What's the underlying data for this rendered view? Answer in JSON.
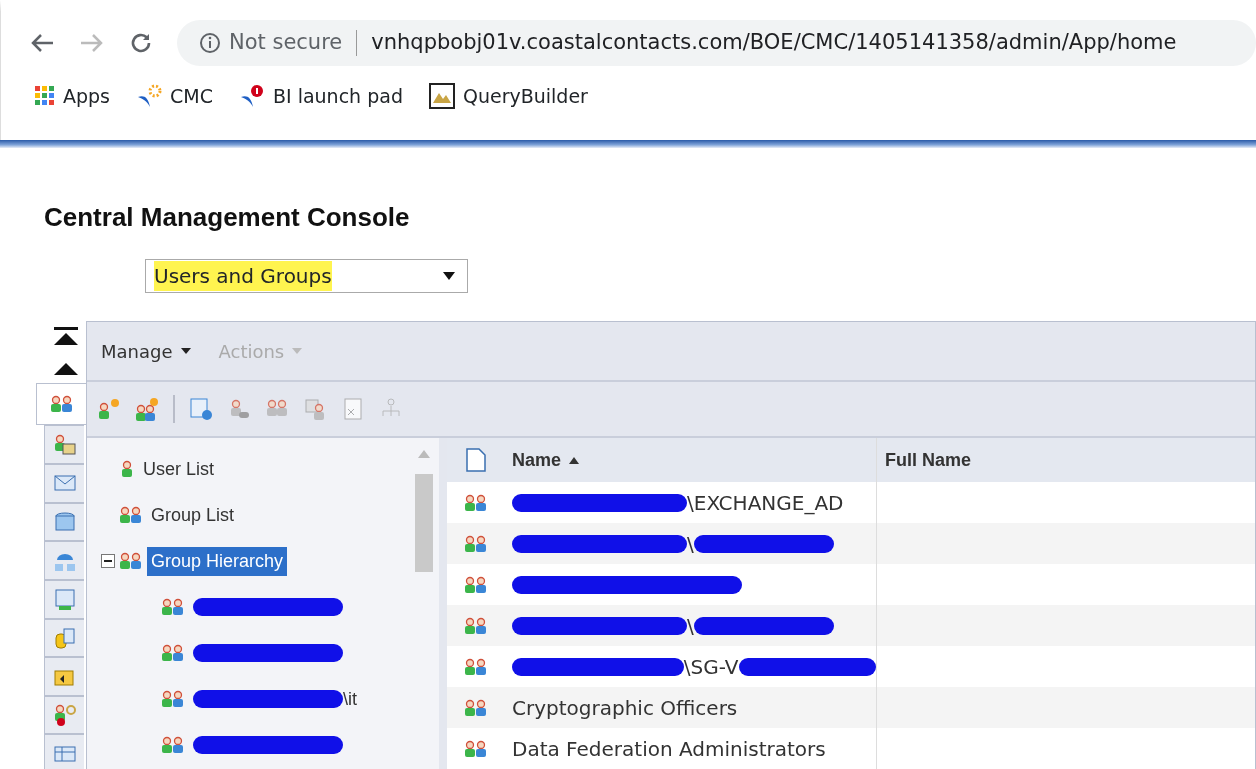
{
  "browser": {
    "security": "Not secure",
    "url": "vnhqpbobj01v.coastalcontacts.com/BOE/CMC/1405141358/admin/App/home",
    "bookmarks": [
      {
        "label": "Apps",
        "kind": "apps"
      },
      {
        "label": "CMC",
        "kind": "cmc"
      },
      {
        "label": "BI launch pad",
        "kind": "bi"
      },
      {
        "label": "QueryBuilder",
        "kind": "query"
      }
    ]
  },
  "page": {
    "title": "Central Management Console",
    "area_select": {
      "value": "Users and Groups",
      "highlighted": true
    }
  },
  "sidebar": {
    "tabs": [
      {
        "selected": true
      },
      {
        "selected": false
      },
      {
        "selected": false
      },
      {
        "selected": false
      },
      {
        "selected": false
      },
      {
        "selected": false
      },
      {
        "selected": false
      },
      {
        "selected": false
      },
      {
        "selected": false
      },
      {
        "selected": false
      }
    ]
  },
  "menu": [
    {
      "label": "Manage",
      "disabled": false
    },
    {
      "label": "Actions",
      "disabled": true
    }
  ],
  "toolbar": [
    {
      "kind": "button",
      "disabled": false
    },
    {
      "kind": "button",
      "disabled": false
    },
    {
      "kind": "separator"
    },
    {
      "kind": "button",
      "disabled": false
    },
    {
      "kind": "button",
      "disabled": true
    },
    {
      "kind": "button",
      "disabled": true
    },
    {
      "kind": "button",
      "disabled": true
    },
    {
      "kind": "button",
      "disabled": true
    },
    {
      "kind": "button",
      "disabled": true
    }
  ],
  "tree": [
    {
      "kind": "user",
      "parts": [
        {
          "kind": "text",
          "text": "User List"
        }
      ],
      "selected": false
    },
    {
      "kind": "group",
      "parts": [
        {
          "kind": "text",
          "text": "Group List"
        }
      ],
      "selected": false
    },
    {
      "kind": "group",
      "parts": [
        {
          "kind": "text",
          "text": "Group Hierarchy"
        }
      ],
      "selected": true,
      "expanded": true,
      "children": [
        {
          "kind": "group",
          "parts": [
            {
              "kind": "redacted"
            }
          ],
          "selected": false
        },
        {
          "kind": "group",
          "parts": [
            {
              "kind": "redacted"
            }
          ],
          "selected": false
        },
        {
          "kind": "group",
          "parts": [
            {
              "kind": "redacted"
            },
            {
              "kind": "text",
              "text": "\\it"
            }
          ],
          "selected": false
        },
        {
          "kind": "group",
          "parts": [
            {
              "kind": "redacted"
            }
          ],
          "selected": false
        }
      ]
    }
  ],
  "table": {
    "columns": [
      {
        "label": "Name",
        "sorted": true
      },
      {
        "label": "Full Name",
        "sorted": false
      }
    ],
    "rows": [
      {
        "name": [
          {
            "kind": "redacted"
          },
          {
            "kind": "text",
            "text": "\\EXCHANGE_AD"
          }
        ]
      },
      {
        "name": [
          {
            "kind": "redacted"
          },
          {
            "kind": "text",
            "text": "\\"
          },
          {
            "kind": "redacted"
          }
        ]
      },
      {
        "name": [
          {
            "kind": "redacted"
          }
        ]
      },
      {
        "name": [
          {
            "kind": "redacted"
          },
          {
            "kind": "text",
            "text": "\\"
          },
          {
            "kind": "redacted"
          }
        ]
      },
      {
        "name": [
          {
            "kind": "redacted"
          },
          {
            "kind": "text",
            "text": "\\SG-V"
          },
          {
            "kind": "redacted"
          }
        ]
      },
      {
        "name": [
          {
            "kind": "text",
            "text": "Cryptographic Officers"
          }
        ]
      },
      {
        "name": [
          {
            "kind": "text",
            "text": "Data Federation Administrators"
          }
        ]
      }
    ]
  }
}
